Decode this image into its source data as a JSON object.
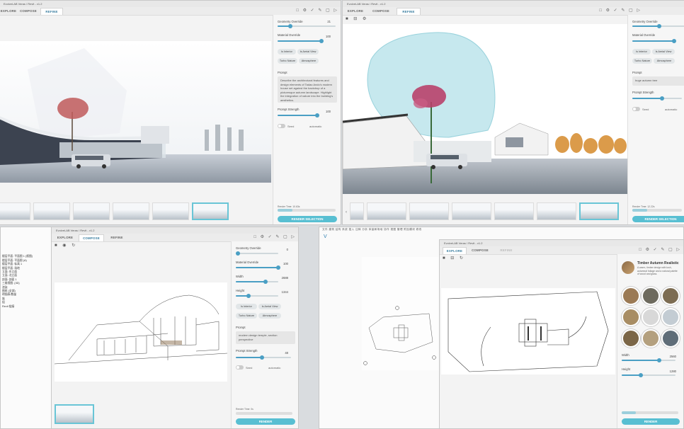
{
  "win1": {
    "title": "EvolveLAB Veras / Revit - v1.2",
    "tabs": [
      "EXPLORE",
      "COMPOSE",
      "REFINE"
    ],
    "geometry_override": {
      "label": "Geometry Override",
      "value": "21",
      "level": 0.22
    },
    "material_override": {
      "label": "Material Override",
      "value": "100",
      "level": 1.0
    },
    "chips": [
      "Is Interior",
      "Is Aerial View",
      "Turbo Nature",
      "Atmosphere"
    ],
    "prompt_label": "Prompt",
    "prompt_text": "Describe the architectural features and design elements of Tadao Ando's modern house set against the backdrop of a picturesque autumn landscape. Highlight the integration of nature into the building's aesthetics.",
    "prompt_strength": {
      "label": "Prompt Strength",
      "value": "100",
      "level": 1.0
    },
    "seed_label": "Seed",
    "seed_value": "automatic",
    "render_time": "Render Time: 10.63s",
    "cta": "RENDER SELECTION"
  },
  "win2": {
    "title": "EvolveLAB Veras / Revit - v1.2",
    "tabs": [
      "EXPLORE",
      "COMPOSE",
      "REFINE"
    ],
    "geometry_override": {
      "label": "Geometry Override",
      "level": 0.42
    },
    "material_override": {
      "label": "Material Override",
      "level": 0.95
    },
    "chips": [
      "Is Interior",
      "Is Aerial View",
      "Turbo Nature",
      "Atmosphere"
    ],
    "prompt_label": "Prompt",
    "prompt_text": "huge autumn tree",
    "prompt_strength": {
      "label": "Prompt Strength",
      "level": 0.6
    },
    "seed_label": "Seed",
    "seed_value": "automatic",
    "render_time": "Render Time: 12.22s",
    "cta": "RENDER SELECTION"
  },
  "win3": {
    "title": "EvolveLAB Veras / Revit - v1.2",
    "tabs": [
      "EXPLORE",
      "COMPOSE",
      "REFINE"
    ],
    "geometry_override": {
      "label": "Geometry Override",
      "value": "0",
      "level": 0.0
    },
    "material_override": {
      "label": "Material Override",
      "value": "100",
      "level": 1.0
    },
    "width": {
      "label": "Width",
      "value": "2688",
      "level": 0.7
    },
    "height": {
      "label": "Height",
      "value": "1344",
      "level": 0.3
    },
    "chips": [
      "Is Interior",
      "Is Aerial View",
      "Turbo Nature",
      "Atmosphere"
    ],
    "prompt_label": "Prompt",
    "prompt_text": "modern design temple, section perspective",
    "prompt_strength": {
      "label": "Prompt Strength",
      "value": "48",
      "level": 0.48
    },
    "seed_label": "Seed",
    "seed_value": "automatic",
    "render_time": "Render Time: 0s",
    "cta": "RENDER"
  },
  "win4": {
    "title": "EvolveLAB Veras / Revit - v1.2",
    "tabs": [
      "EXPLORE",
      "COMPOSE",
      "REFINE"
    ],
    "style_title": "Timber Autumn Realistic",
    "style_desc": "A warm, timber design with lush, autumnal foliage and a natural palette of wood and glass.",
    "width": {
      "label": "Width",
      "value": "2560",
      "level": 0.7
    },
    "height": {
      "label": "Height",
      "value": "1280",
      "level": 0.35
    },
    "cta": "RENDER"
  },
  "left_tree": [
    "楼层平面: 平面图 1 (视图)",
    "楼层平面: 平面图 (A)",
    "楼层平面: 标高 1",
    "楼层平面: 场地",
    "立面: 东立面",
    "立面: 北立面",
    "剖面: 剖面 1",
    "三维视图: {3D}",
    "渲染",
    "图纸 (全部)",
    "明细表/数量",
    "族",
    "组",
    "Revit 链接"
  ],
  "colors": {
    "accent": "#4a9fc4",
    "cta": "#58bfd2"
  }
}
